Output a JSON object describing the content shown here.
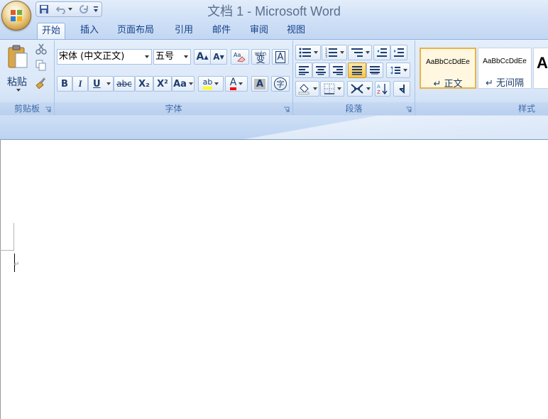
{
  "window": {
    "title": "文档 1 - Microsoft Word"
  },
  "tabs": [
    {
      "label": "开始",
      "active": true
    },
    {
      "label": "插入"
    },
    {
      "label": "页面布局"
    },
    {
      "label": "引用"
    },
    {
      "label": "邮件"
    },
    {
      "label": "审阅"
    },
    {
      "label": "视图"
    }
  ],
  "clipboard": {
    "paste_label": "粘贴",
    "group_label": "剪贴板"
  },
  "font": {
    "name": "宋体 (中文正文)",
    "size": "五号",
    "group_label": "字体",
    "phonetic_glyph": "wén",
    "phonetic_char": "变",
    "border_char": "A",
    "bold": "B",
    "italic": "I",
    "underline": "U",
    "strike": "abc",
    "subscript": "X₂",
    "superscript": "X²",
    "case": "Aa",
    "highlight": "ab",
    "color_letter": "A",
    "shade_letter": "A",
    "enclose_char": "字",
    "grow": "A",
    "shrink": "A"
  },
  "paragraph": {
    "group_label": "段落"
  },
  "styles": {
    "group_label": "样式",
    "items": [
      {
        "preview": "AaBbCcDdEe",
        "name": "↵ 正文",
        "selected": true
      },
      {
        "preview": "AaBbCcDdEe",
        "name": "↵ 无间隔"
      },
      {
        "preview": "A",
        "name": ""
      }
    ]
  },
  "document": {
    "paragraph_mark": "↵"
  },
  "colors": {
    "highlight": "#ffff00",
    "font_color": "#ff0000",
    "accent": "#15428b"
  }
}
